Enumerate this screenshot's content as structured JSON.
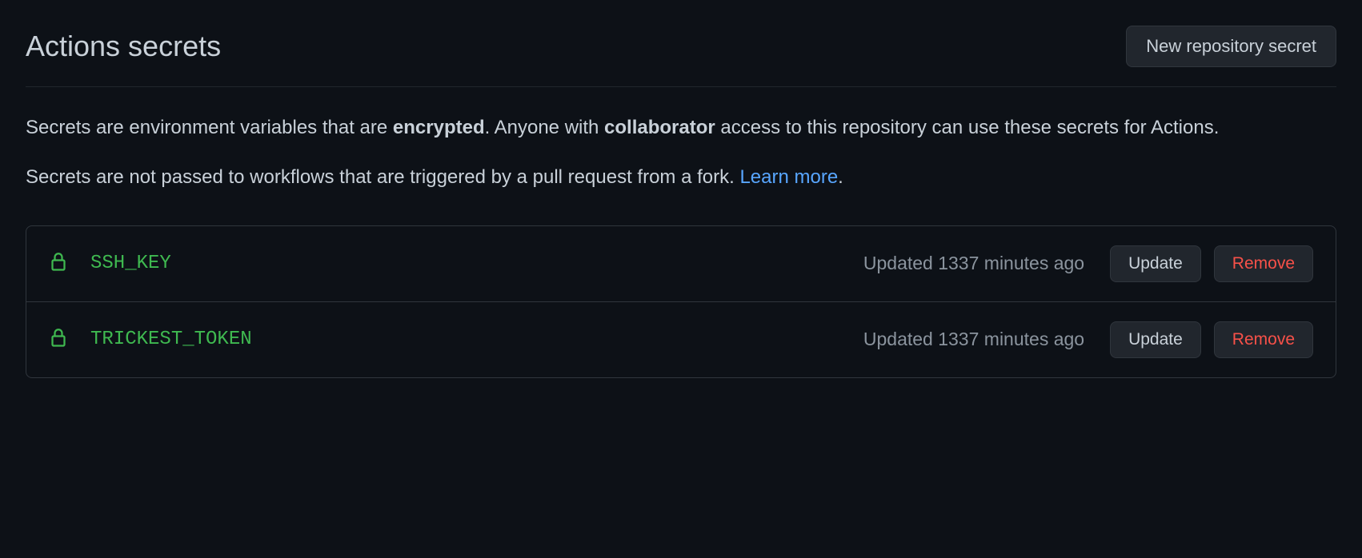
{
  "header": {
    "title": "Actions secrets",
    "new_button": "New repository secret"
  },
  "description": {
    "pre1": "Secrets are environment variables that are ",
    "bold1": "encrypted",
    "mid1": ". Anyone with ",
    "bold2": "collaborator",
    "post1": " access to this repository can use these secrets for Actions."
  },
  "learn_more": {
    "text": "Secrets are not passed to workflows that are triggered by a pull request from a fork. ",
    "link": "Learn more",
    "suffix": "."
  },
  "secrets": [
    {
      "name": "SSH_KEY",
      "updated": "Updated 1337 minutes ago",
      "update_label": "Update",
      "remove_label": "Remove"
    },
    {
      "name": "TRICKEST_TOKEN",
      "updated": "Updated 1337 minutes ago",
      "update_label": "Update",
      "remove_label": "Remove"
    }
  ]
}
